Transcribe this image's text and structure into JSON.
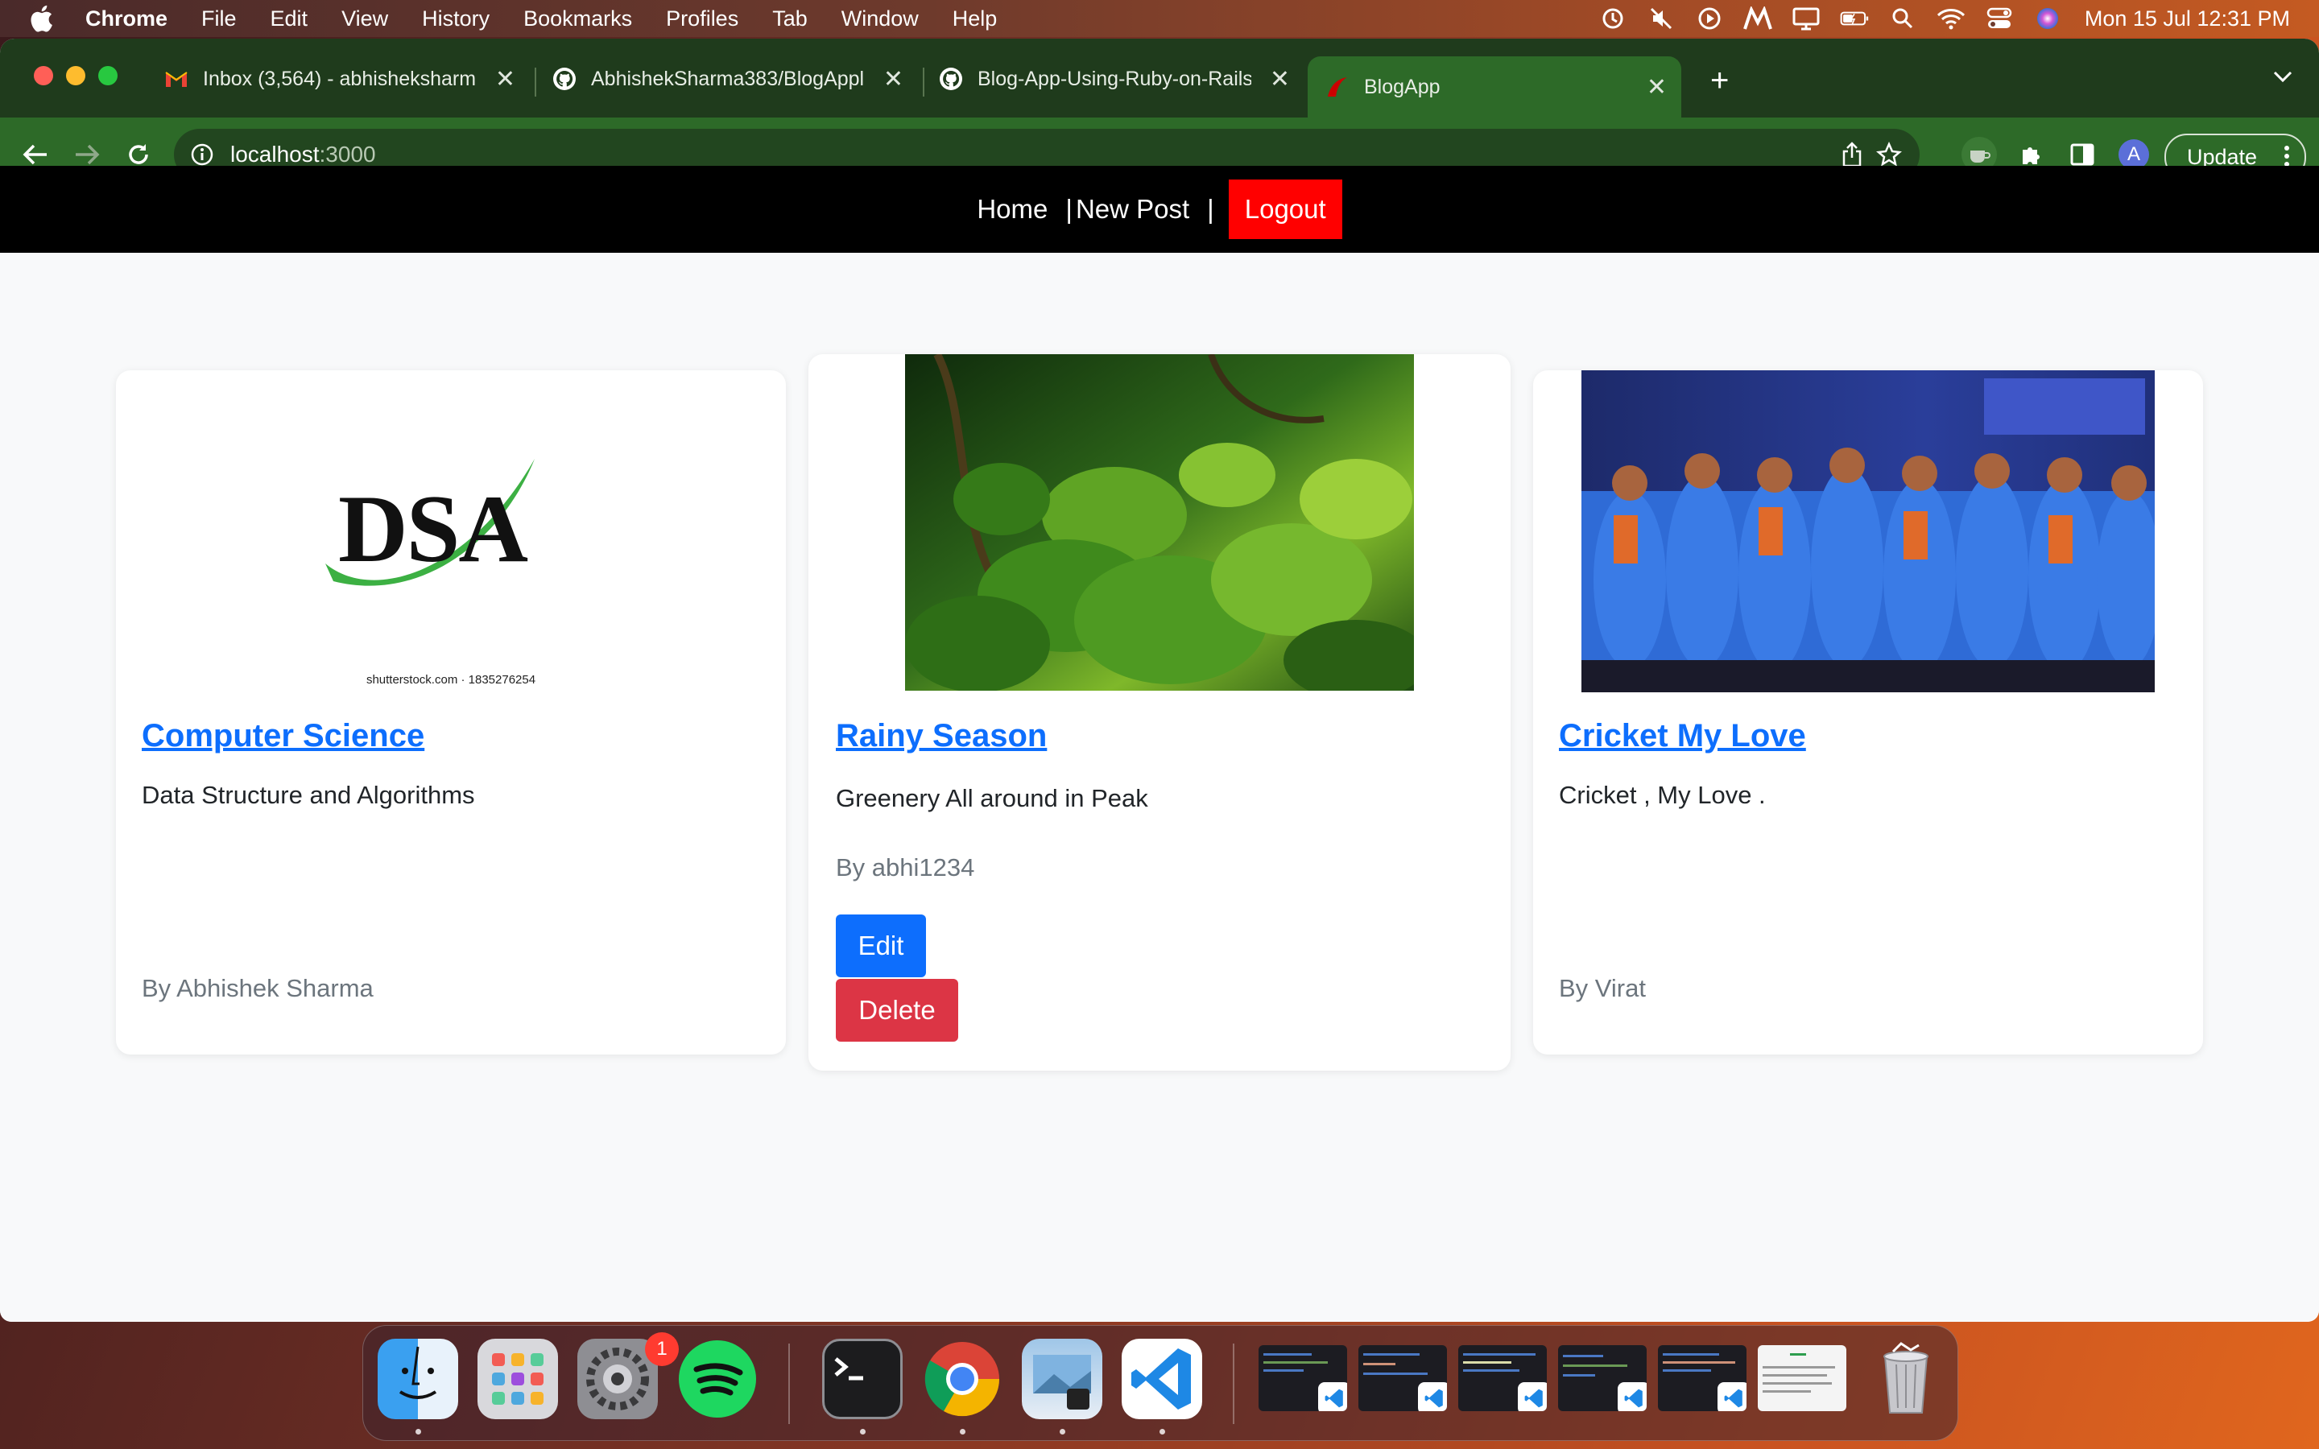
{
  "menubar": {
    "app_name": "Chrome",
    "items": [
      "File",
      "Edit",
      "View",
      "History",
      "Bookmarks",
      "Profiles",
      "Tab",
      "Window",
      "Help"
    ],
    "clock": "Mon 15 Jul  12:31 PM",
    "status_icons": [
      "sync-icon",
      "mute-icon",
      "play-icon",
      "malwarebytes-icon",
      "display-icon",
      "battery-icon",
      "spotlight-icon",
      "wifi-icon",
      "control-center-icon",
      "siri-icon"
    ]
  },
  "browser": {
    "tabs": [
      {
        "title": "Inbox (3,564) - abhisheksharm",
        "icon": "gmail-icon"
      },
      {
        "title": "AbhishekSharma383/BlogAppli",
        "icon": "github-icon"
      },
      {
        "title": "Blog-App-Using-Ruby-on-Rails",
        "icon": "github-icon"
      },
      {
        "title": "BlogApp",
        "icon": "rails-icon",
        "active": true
      }
    ],
    "url_host": "localhost",
    "url_port": ":3000",
    "profile_initial": "A",
    "update_label": "Update"
  },
  "navbar": {
    "home": "Home",
    "separator": "|",
    "new_post": "New Post",
    "logout": "Logout"
  },
  "posts": [
    {
      "image_caption": "shutterstock.com · 1835276254",
      "image_logo_text": "DSA",
      "title": "Computer Science",
      "body": "Data Structure and Algorithms",
      "author": "By Abhishek Sharma"
    },
    {
      "title": "Rainy Season",
      "body": "Greenery All around in Peak",
      "author": "By abhi1234",
      "edit_label": "Edit",
      "delete_label": "Delete"
    },
    {
      "title": "Cricket My Love",
      "body": "Cricket , My Love .",
      "author": "By Virat"
    }
  ],
  "dock": {
    "apps": [
      "finder-icon",
      "launchpad-icon",
      "system-settings-icon",
      "spotify-icon",
      "terminal-icon",
      "chrome-icon",
      "preview-icon",
      "vscode-icon"
    ],
    "settings_badge": "1",
    "minimized_windows": 6
  },
  "colors": {
    "tabstrip": "#1f3b1c",
    "toolbar": "#2d6a28",
    "link": "#0d6efd",
    "edit": "#0d6efd",
    "delete": "#dc3545",
    "logout": "#ff0000"
  }
}
